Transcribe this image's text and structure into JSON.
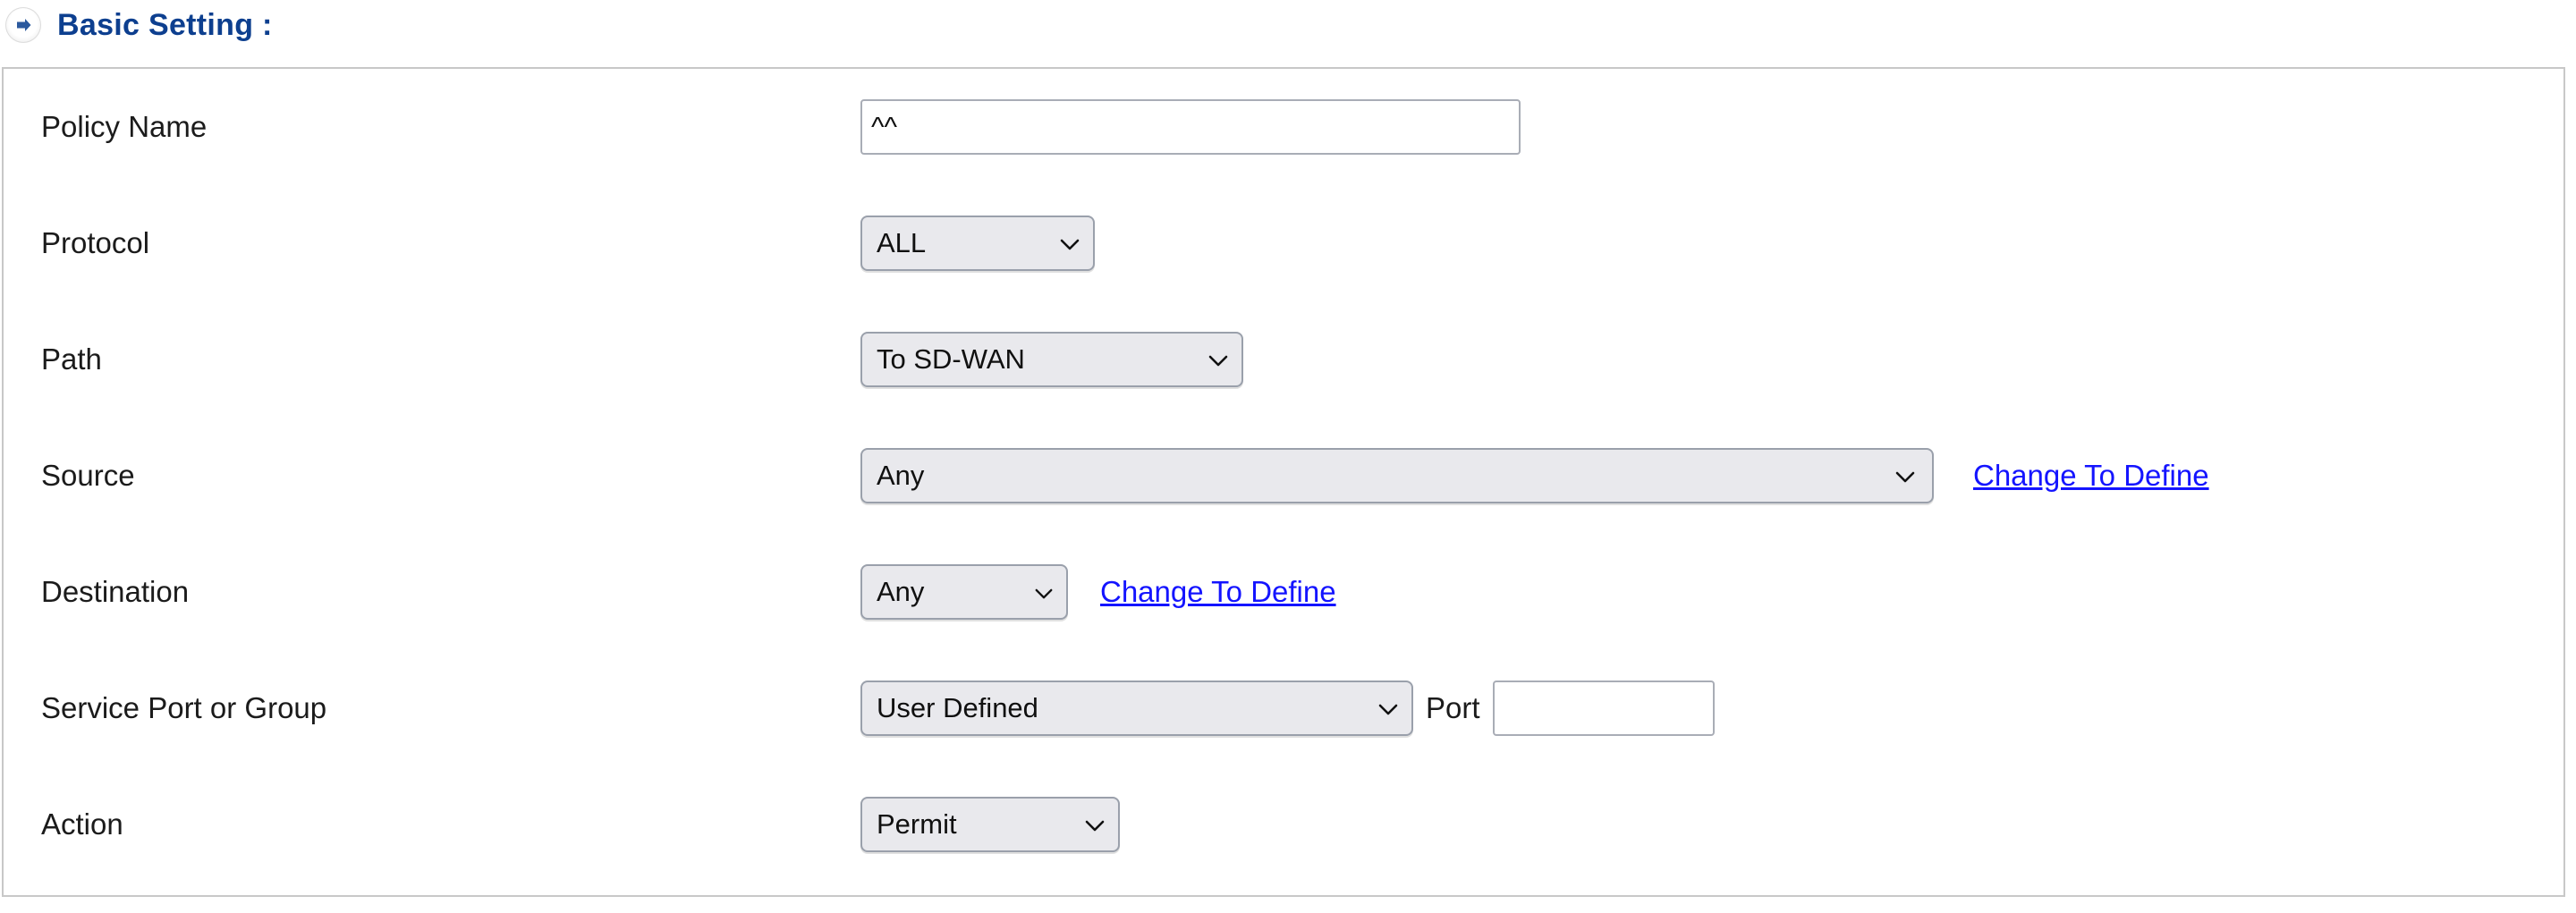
{
  "section": {
    "expand_icon": "circle-arrow-right-icon",
    "title": "Basic Setting :"
  },
  "colors": {
    "title_blue": "#0d3f8f",
    "link_blue": "#1414ff",
    "control_bg": "#e9e9ed",
    "control_border": "#9aa0ab",
    "panel_border": "#c8c8c8",
    "text": "#1b1b1b"
  },
  "form": {
    "rows": [
      {
        "label": "Policy Name",
        "control": "text",
        "value": "^^",
        "placeholder": ""
      },
      {
        "label": "Protocol",
        "control": "select",
        "value": "ALL"
      },
      {
        "label": "Path",
        "control": "select",
        "value": "To SD-WAN"
      },
      {
        "label": "Source",
        "control": "select",
        "value": "Any",
        "link": "Change To Define"
      },
      {
        "label": "Destination",
        "control": "select",
        "value": "Any",
        "link": "Change To Define"
      },
      {
        "label": "Service Port or Group",
        "control": "select",
        "value": "User Defined",
        "inline_label": "Port",
        "port_value": "",
        "port_placeholder": ""
      },
      {
        "label": "Action",
        "control": "select",
        "value": "Permit"
      }
    ]
  }
}
